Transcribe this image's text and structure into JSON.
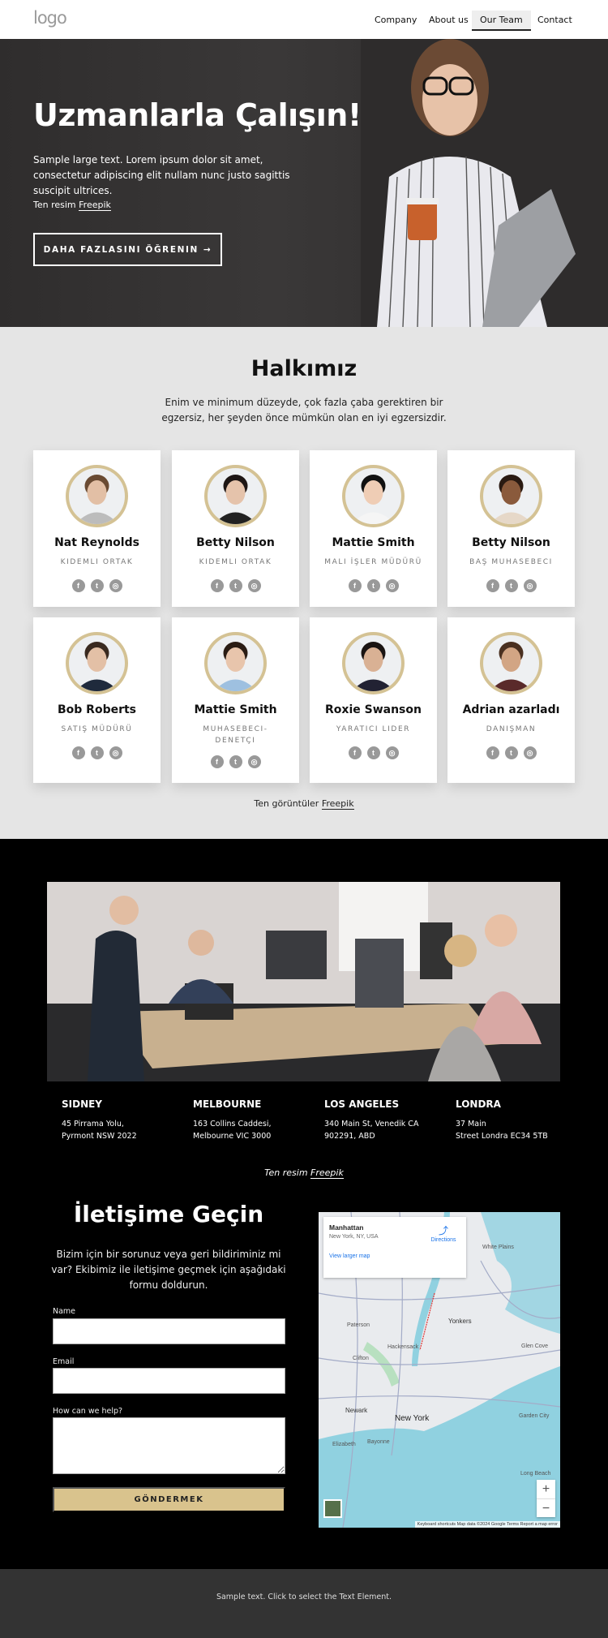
{
  "header": {
    "logo": "logo",
    "nav": [
      {
        "label": "Company"
      },
      {
        "label": "About us"
      },
      {
        "label": "Our Team",
        "active": true
      },
      {
        "label": "Contact"
      }
    ]
  },
  "hero": {
    "title": "Uzmanlarla Çalışın!",
    "text": "Sample large text. Lorem ipsum dolor sit amet, consectetur adipiscing elit nullam nunc justo sagittis suscipit ultrices.",
    "credit_prefix": "Ten resim",
    "credit_link": "Freepik",
    "button": "DAHA FAZLASINI ÖĞRENIN",
    "button_icon": "arrow-right-icon"
  },
  "team": {
    "title": "Halkımız",
    "lead": "Enim ve minimum düzeyde, çok fazla çaba gerektiren bir egzersiz, her şeyden önce mümkün olan en iyi egzersizdir.",
    "members": [
      {
        "name": "Nat Reynolds",
        "role": "KIDEMLI ORTAK"
      },
      {
        "name": "Betty Nilson",
        "role": "KIDEMLI ORTAK"
      },
      {
        "name": "Mattie Smith",
        "role": "MALI İŞLER MÜDÜRÜ"
      },
      {
        "name": "Betty Nilson",
        "role": "BAŞ MUHASEBECI"
      },
      {
        "name": "Bob Roberts",
        "role": "SATIŞ MÜDÜRÜ"
      },
      {
        "name": "Mattie Smith",
        "role": "MUHASEBECI-DENETÇI"
      },
      {
        "name": "Roxie Swanson",
        "role": "YARATICI LIDER"
      },
      {
        "name": "Adrian azarladı",
        "role": "DANIŞMAN"
      }
    ],
    "social_icons": [
      "facebook-icon",
      "twitter-icon",
      "instagram-icon"
    ],
    "credit_prefix": "Ten görüntüler",
    "credit_link": "Freepik"
  },
  "offices": {
    "cities": [
      {
        "name": "SIDNEY",
        "line1": "45 Pirrama Yolu,",
        "line2": "Pyrmont NSW 2022"
      },
      {
        "name": "MELBOURNE",
        "line1": "163 Collins Caddesi,",
        "line2": "Melbourne VIC 3000"
      },
      {
        "name": "LOS ANGELES",
        "line1": "340 Main St, Venedik CA",
        "line2": "902291, ABD"
      },
      {
        "name": "LONDRA",
        "line1": "37 Main",
        "line2": "Street Londra EC34 5TB"
      }
    ],
    "credit_prefix": "Ten resim",
    "credit_link": "Freepik"
  },
  "contact": {
    "title": "İletişime Geçin",
    "text": "Bizim için bir sorunuz veya geri bildiriminiz mi var? Ekibimiz ile iletişime geçmek için aşağıdaki formu doldurun.",
    "name_label": "Name",
    "email_label": "Email",
    "help_label": "How can we help?",
    "submit": "GÖNDERMEK",
    "map": {
      "place": "Manhattan",
      "address": "New York, NY, USA",
      "directions": "Directions",
      "larger": "View larger map",
      "labels": [
        "Yonkers",
        "White Plains",
        "Paterson",
        "Hackensack",
        "Clifton",
        "Newark",
        "New York",
        "Elizabeth",
        "Bayonne",
        "Long Beach",
        "Glen Cove",
        "Garden City"
      ],
      "zoom_in": "+",
      "zoom_out": "−",
      "attribution": "Keyboard shortcuts  Map data ©2024 Google  Terms  Report a map error"
    }
  },
  "colors": {
    "accent": "#d9c38d",
    "dark": "#000000",
    "footer": "#333333",
    "section": "#e5e5e5"
  },
  "footer": {
    "text": "Sample text. Click to select the Text Element."
  }
}
